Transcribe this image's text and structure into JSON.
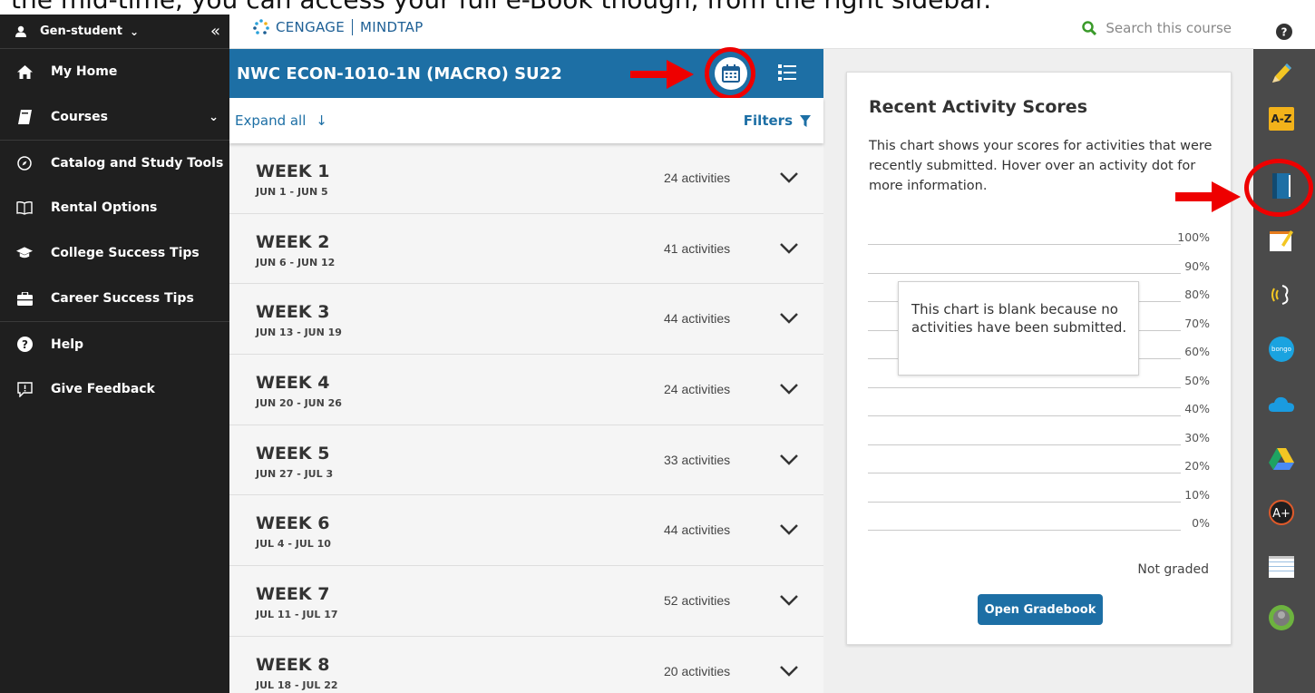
{
  "banner": {
    "caption": "the mid-time, you can access your full e-Book though, from the right sidebar."
  },
  "sidebar": {
    "user_name": "Gen-student",
    "items": [
      {
        "label": "My Home",
        "icon": "home-icon"
      },
      {
        "label": "Courses",
        "icon": "book-icon"
      },
      {
        "label": "Catalog and Study Tools",
        "icon": "compass-icon"
      },
      {
        "label": "Rental Options",
        "icon": "open-book-icon"
      },
      {
        "label": "College Success Tips",
        "icon": "graduation-cap-icon"
      },
      {
        "label": "Career Success Tips",
        "icon": "briefcase-icon"
      },
      {
        "label": "Help",
        "icon": "question-icon"
      },
      {
        "label": "Give Feedback",
        "icon": "feedback-icon"
      }
    ]
  },
  "header": {
    "brand_left": "CENGAGE",
    "brand_right": "MINDTAP",
    "search_placeholder": "Search this course"
  },
  "course": {
    "title": "NWC ECON-1010-1N (MACRO) SU22",
    "expand_all": "Expand all",
    "filters": "Filters",
    "weeks": [
      {
        "title": "WEEK 1",
        "dates": "JUN 1 - JUN 5",
        "activities": "24 activities"
      },
      {
        "title": "WEEK 2",
        "dates": "JUN 6 - JUN 12",
        "activities": "41 activities"
      },
      {
        "title": "WEEK 3",
        "dates": "JUN 13 - JUN 19",
        "activities": "44 activities"
      },
      {
        "title": "WEEK 4",
        "dates": "JUN 20 - JUN 26",
        "activities": "24 activities"
      },
      {
        "title": "WEEK 5",
        "dates": "JUN 27 - JUL 3",
        "activities": "33 activities"
      },
      {
        "title": "WEEK 6",
        "dates": "JUL 4 - JUL 10",
        "activities": "44 activities"
      },
      {
        "title": "WEEK 7",
        "dates": "JUL 11 - JUL 17",
        "activities": "52 activities"
      },
      {
        "title": "WEEK 8",
        "dates": "JUL 18 - JUL 22",
        "activities": "20 activities"
      }
    ]
  },
  "scores": {
    "title": "Recent Activity Scores",
    "description": "This chart shows your scores for activities that were recently submitted. Hover over an activity dot for more information.",
    "ticks": [
      "100%",
      "90%",
      "80%",
      "70%",
      "60%",
      "50%",
      "40%",
      "30%",
      "20%",
      "10%",
      "0%"
    ],
    "blank_message": "This chart is blank because no activities have been submitted.",
    "not_graded": "Not graded",
    "gradebook_button": "Open Gradebook"
  },
  "dock": {
    "items": [
      "pencil-icon",
      "dictionary-icon",
      "ebook-icon",
      "notes-icon",
      "readspeaker-icon",
      "bongo-icon",
      "onedrive-icon",
      "google-drive-icon",
      "aplia-icon",
      "flashcards-icon",
      "profile-icon"
    ],
    "bongo_label": "bongo",
    "dictionary_label": "A-Z"
  },
  "colors": {
    "accent": "#1d6fa5",
    "sidebar": "#1f1f1f",
    "dock": "#4a4a4a",
    "annotation": "#e00000"
  }
}
